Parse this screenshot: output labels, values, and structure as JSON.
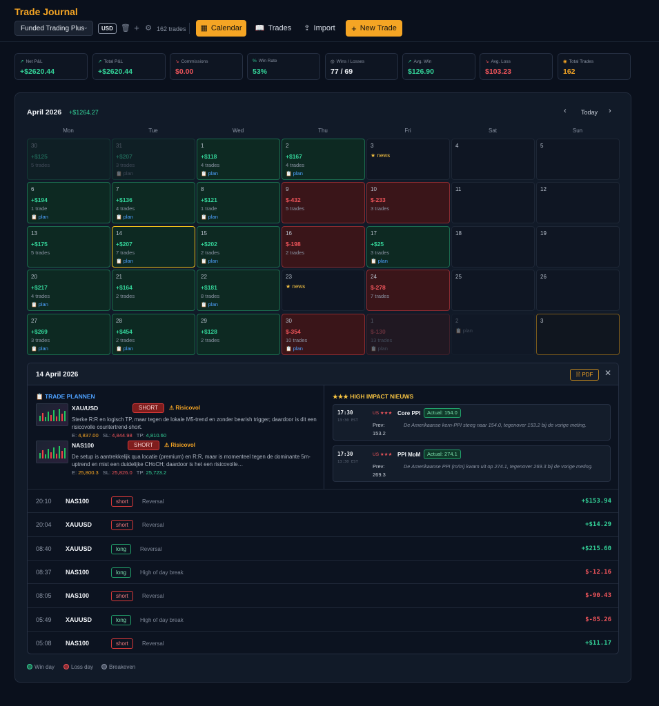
{
  "header": {
    "title": "Trade Journal",
    "account": "Funded Trading Plus",
    "currency": "USD",
    "trade_count": "162 trades",
    "buttons": {
      "calendar": "Calendar",
      "trades": "Trades",
      "import": "Import",
      "new_trade": "New Trade"
    }
  },
  "stats": [
    {
      "label": "Net P&L",
      "value": "+$2620.44",
      "tone": "green",
      "icon": "trend-up-icon"
    },
    {
      "label": "Total P&L",
      "value": "+$2620.44",
      "tone": "green",
      "icon": "trend-up-icon"
    },
    {
      "label": "Commissions",
      "value": "$0.00",
      "tone": "red",
      "icon": "trend-down-icon"
    },
    {
      "label": "Win Rate",
      "value": "53%",
      "tone": "green",
      "icon": "percent-icon"
    },
    {
      "label": "Wins / Losses",
      "value": "77 / 69",
      "tone": "white",
      "icon": "target-icon"
    },
    {
      "label": "Avg. Win",
      "value": "$126.90",
      "tone": "green",
      "icon": "trend-up-icon"
    },
    {
      "label": "Avg. Loss",
      "value": "$103.23",
      "tone": "red",
      "icon": "trend-down-icon"
    },
    {
      "label": "Total Trades",
      "value": "162",
      "tone": "amber",
      "icon": "coin-icon"
    }
  ],
  "calendar": {
    "month": "April 2026",
    "month_pnl": "+$1264.27",
    "today_label": "Today",
    "weekdays": [
      "Mon",
      "Tue",
      "Wed",
      "Thu",
      "Fri",
      "Sat",
      "Sun"
    ],
    "days": [
      {
        "day": "30",
        "pnl": "+$125",
        "trades": "5 trades",
        "plan": false,
        "news": false,
        "state": "win",
        "other": true
      },
      {
        "day": "31",
        "pnl": "+$207",
        "trades": "3 trades",
        "plan": true,
        "news": false,
        "state": "win",
        "other": true
      },
      {
        "day": "1",
        "pnl": "+$118",
        "trades": "4 trades",
        "plan": true,
        "news": false,
        "state": "win"
      },
      {
        "day": "2",
        "pnl": "+$167",
        "trades": "4 trades",
        "plan": true,
        "news": false,
        "state": "win"
      },
      {
        "day": "3",
        "pnl": "",
        "trades": "",
        "plan": false,
        "news": true,
        "state": "none"
      },
      {
        "day": "4",
        "pnl": "",
        "trades": "",
        "plan": false,
        "news": false,
        "state": "none"
      },
      {
        "day": "5",
        "pnl": "",
        "trades": "",
        "plan": false,
        "news": false,
        "state": "none"
      },
      {
        "day": "6",
        "pnl": "+$194",
        "trades": "1 trade",
        "plan": true,
        "news": false,
        "state": "win"
      },
      {
        "day": "7",
        "pnl": "+$136",
        "trades": "4 trades",
        "plan": true,
        "news": false,
        "state": "win"
      },
      {
        "day": "8",
        "pnl": "+$121",
        "trades": "1 trade",
        "plan": true,
        "news": false,
        "state": "win"
      },
      {
        "day": "9",
        "pnl": "$-432",
        "trades": "5 trades",
        "plan": false,
        "news": false,
        "state": "loss"
      },
      {
        "day": "10",
        "pnl": "$-233",
        "trades": "3 trades",
        "plan": false,
        "news": false,
        "state": "loss"
      },
      {
        "day": "11",
        "pnl": "",
        "trades": "",
        "plan": false,
        "news": false,
        "state": "none"
      },
      {
        "day": "12",
        "pnl": "",
        "trades": "",
        "plan": false,
        "news": false,
        "state": "none"
      },
      {
        "day": "13",
        "pnl": "+$175",
        "trades": "5 trades",
        "plan": false,
        "news": false,
        "state": "win"
      },
      {
        "day": "14",
        "pnl": "+$207",
        "trades": "7 trades",
        "plan": true,
        "news": false,
        "state": "win",
        "today": true
      },
      {
        "day": "15",
        "pnl": "+$202",
        "trades": "2 trades",
        "plan": true,
        "news": false,
        "state": "win"
      },
      {
        "day": "16",
        "pnl": "$-198",
        "trades": "2 trades",
        "plan": false,
        "news": false,
        "state": "loss"
      },
      {
        "day": "17",
        "pnl": "+$25",
        "trades": "3 trades",
        "plan": true,
        "news": false,
        "state": "win"
      },
      {
        "day": "18",
        "pnl": "",
        "trades": "",
        "plan": false,
        "news": false,
        "state": "none"
      },
      {
        "day": "19",
        "pnl": "",
        "trades": "",
        "plan": false,
        "news": false,
        "state": "none"
      },
      {
        "day": "20",
        "pnl": "+$217",
        "trades": "4 trades",
        "plan": true,
        "news": false,
        "state": "win"
      },
      {
        "day": "21",
        "pnl": "+$164",
        "trades": "2 trades",
        "plan": false,
        "news": false,
        "state": "win"
      },
      {
        "day": "22",
        "pnl": "+$181",
        "trades": "8 trades",
        "plan": true,
        "news": false,
        "state": "win"
      },
      {
        "day": "23",
        "pnl": "",
        "trades": "",
        "plan": false,
        "news": true,
        "state": "none"
      },
      {
        "day": "24",
        "pnl": "$-278",
        "trades": "7 trades",
        "plan": false,
        "news": false,
        "state": "loss"
      },
      {
        "day": "25",
        "pnl": "",
        "trades": "",
        "plan": false,
        "news": false,
        "state": "none"
      },
      {
        "day": "26",
        "pnl": "",
        "trades": "",
        "plan": false,
        "news": false,
        "state": "none"
      },
      {
        "day": "27",
        "pnl": "+$269",
        "trades": "3 trades",
        "plan": true,
        "news": false,
        "state": "win"
      },
      {
        "day": "28",
        "pnl": "+$454",
        "trades": "2 trades",
        "plan": true,
        "news": false,
        "state": "win"
      },
      {
        "day": "29",
        "pnl": "+$128",
        "trades": "2 trades",
        "plan": false,
        "news": false,
        "state": "win"
      },
      {
        "day": "30",
        "pnl": "$-354",
        "trades": "10 trades",
        "plan": true,
        "news": false,
        "state": "loss"
      },
      {
        "day": "1",
        "pnl": "$-130",
        "trades": "13 trades",
        "plan": true,
        "news": false,
        "state": "loss",
        "other": true
      },
      {
        "day": "2",
        "pnl": "",
        "trades": "",
        "plan": true,
        "news": false,
        "state": "none",
        "other": true
      },
      {
        "day": "3",
        "pnl": "",
        "trades": "",
        "plan": false,
        "news": false,
        "state": "future",
        "other": true
      }
    ],
    "plan_label": "plan",
    "news_label": "news"
  },
  "detail": {
    "date": "14 April 2026",
    "pdf_label": "PDF",
    "plans_heading": "TRADE PLANNEN",
    "news_heading": "HIGH IMPACT NIEUWS",
    "plans": [
      {
        "symbol": "XAU/USD",
        "direction": "SHORT",
        "risk": "Risicovol",
        "description": "Sterke R:R en logisch TP, maar tegen de lokale M5-trend en zonder bearish trigger; daardoor is dit een risicovolle countertrend-short.",
        "e_label": "E:",
        "entry": "4,837.00",
        "sl_label": "SL:",
        "sl": "4,844.98",
        "tp_label": "TP:",
        "tp": "4,810.60"
      },
      {
        "symbol": "NAS100",
        "direction": "SHORT",
        "risk": "Risicovol",
        "description": "De setup is aantrekkelijk qua locatie (premium) en R:R, maar is momenteel tegen de dominante 5m-uptrend en mist een duidelijke CHoCH; daardoor is het een risicovolle…",
        "e_label": "E:",
        "entry": "25,800.3",
        "sl_label": "SL:",
        "sl": "25,826.0",
        "tp_label": "TP:",
        "tp": "25,723.2"
      }
    ],
    "news": [
      {
        "time": "17:30",
        "tz": "13:30 EST",
        "flag": "US ★★★",
        "name": "Core PPI",
        "actual": "Actual: 154.0",
        "prev_label": "Prev:",
        "prev": "153.2",
        "description": "De Amerikaanse kern-PPI steeg naar 154.0, tegenover 153.2 bij de vorige meting."
      },
      {
        "time": "17:30",
        "tz": "13:30 EST",
        "flag": "US ★★★",
        "name": "PPI MoM",
        "actual": "Actual: 274.1",
        "prev_label": "Prev:",
        "prev": "269.3",
        "description": "De Amerikaanse PPI (m/m) kwam uit op 274.1, tegenover 269.3 bij de vorige meting."
      }
    ],
    "trades": [
      {
        "time": "20:10",
        "symbol": "NAS100",
        "direction": "short",
        "setup": "Reversal",
        "pnl": "+$153.94",
        "tone": "green"
      },
      {
        "time": "20:04",
        "symbol": "XAUUSD",
        "direction": "short",
        "setup": "Reversal",
        "pnl": "+$14.29",
        "tone": "green"
      },
      {
        "time": "08:40",
        "symbol": "XAUUSD",
        "direction": "long",
        "setup": "Reversal",
        "pnl": "+$215.60",
        "tone": "green"
      },
      {
        "time": "08:37",
        "symbol": "NAS100",
        "direction": "long",
        "setup": "High of day break",
        "pnl": "$-12.16",
        "tone": "red"
      },
      {
        "time": "08:05",
        "symbol": "NAS100",
        "direction": "short",
        "setup": "Reversal",
        "pnl": "$-90.43",
        "tone": "red"
      },
      {
        "time": "05:49",
        "symbol": "XAUUSD",
        "direction": "long",
        "setup": "High of day break",
        "pnl": "$-85.26",
        "tone": "red"
      },
      {
        "time": "05:08",
        "symbol": "NAS100",
        "direction": "short",
        "setup": "Reversal",
        "pnl": "+$11.17",
        "tone": "green"
      }
    ]
  },
  "legend": [
    {
      "label": "Win day",
      "color": "#1f6e51"
    },
    {
      "label": "Loss day",
      "color": "#8b2b31"
    },
    {
      "label": "Breakeven",
      "color": "#4a5264"
    }
  ],
  "colors": {
    "accent": "#f5a524",
    "win": "#34d399",
    "loss": "#f0555b",
    "plan": "#4ea1ff"
  }
}
